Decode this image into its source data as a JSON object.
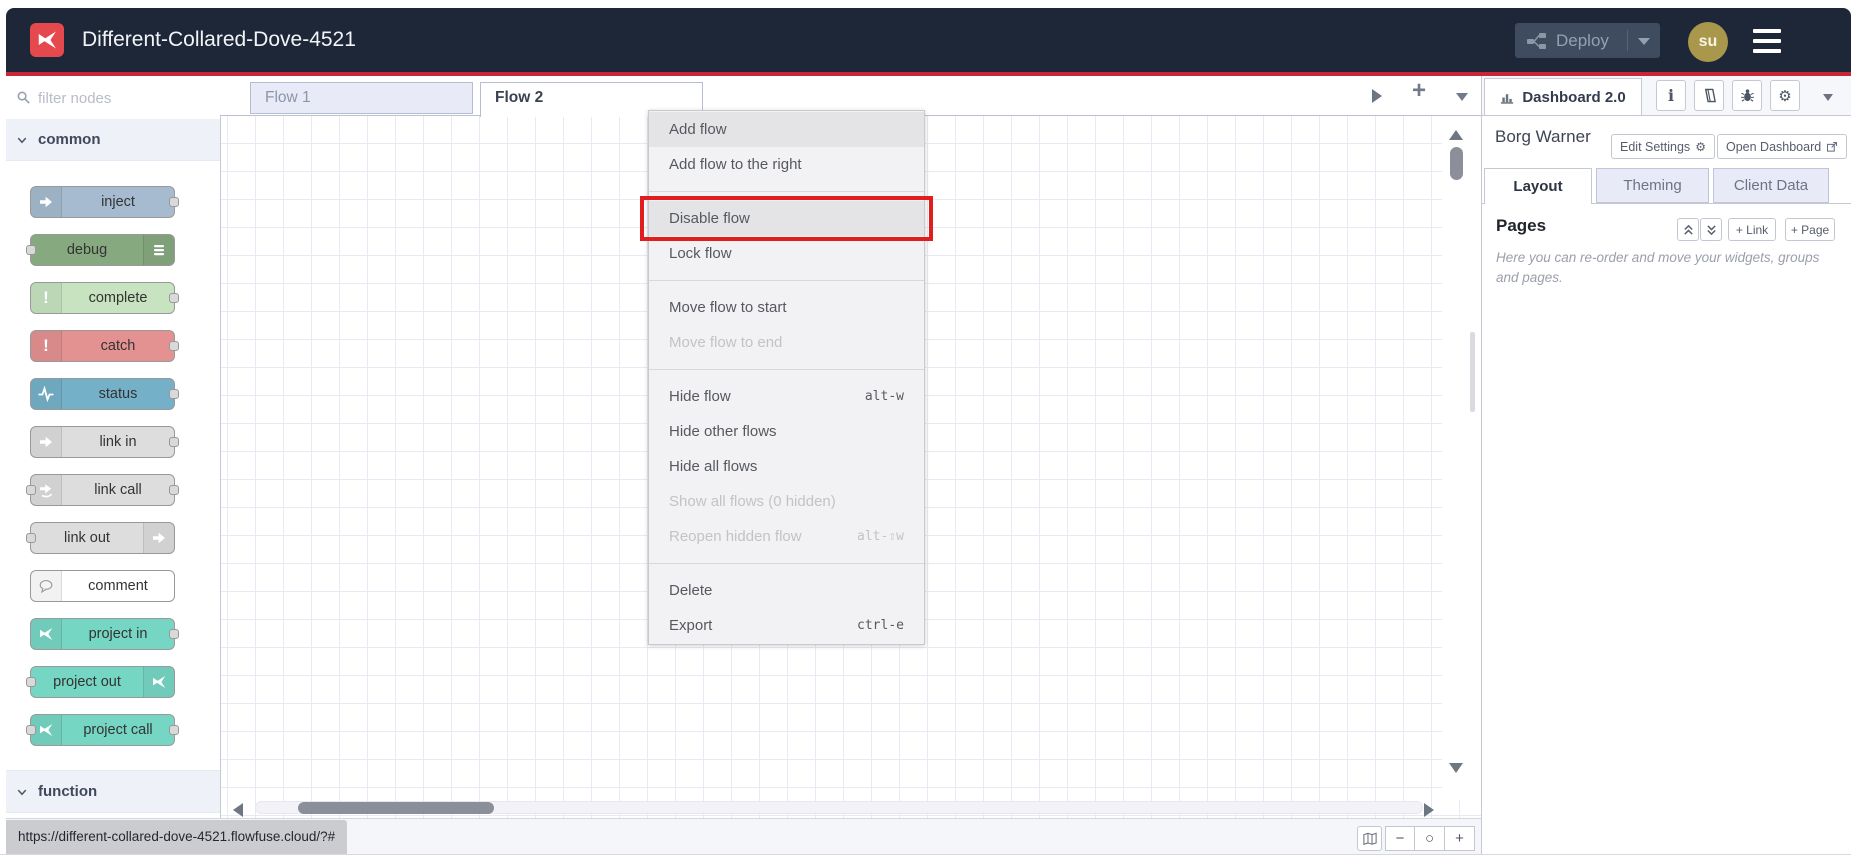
{
  "header": {
    "title": "Different-Collared-Dove-4521",
    "deploy": {
      "label": "Deploy"
    },
    "avatar": {
      "initials": "su"
    }
  },
  "palette": {
    "filter_placeholder": "filter nodes",
    "sections": [
      {
        "label": "common"
      },
      {
        "label": "function"
      }
    ],
    "nodes": [
      {
        "label": "inject",
        "color": "#a6bbcf",
        "icon": "inject-arrow-icon",
        "icon_side": "left",
        "ports": [
          "right"
        ]
      },
      {
        "label": "debug",
        "color": "#87a980",
        "icon": "list-lines-icon",
        "icon_side": "right",
        "ports": [
          "left"
        ]
      },
      {
        "label": "complete",
        "color": "#c7e3c0",
        "icon": "exclamation-icon",
        "icon_side": "left",
        "ports": [
          "right"
        ]
      },
      {
        "label": "catch",
        "color": "#e49191",
        "icon": "exclamation-icon",
        "icon_side": "left",
        "ports": [
          "right"
        ]
      },
      {
        "label": "status",
        "color": "#74b1c9",
        "icon": "pulse-icon",
        "icon_side": "left",
        "ports": [
          "right"
        ]
      },
      {
        "label": "link in",
        "color": "#dddddd",
        "icon": "link-arrow-icon",
        "icon_side": "left",
        "ports": [
          "right"
        ]
      },
      {
        "label": "link call",
        "color": "#dddddd",
        "icon": "link-loop-icon",
        "icon_side": "left",
        "ports": [
          "left",
          "right"
        ]
      },
      {
        "label": "link out",
        "color": "#dddddd",
        "icon": "link-arrow-icon",
        "icon_side": "right",
        "ports": [
          "left"
        ]
      },
      {
        "label": "comment",
        "color": "#ffffff",
        "icon": "comment-bubble-icon",
        "icon_side": "left",
        "ports": []
      },
      {
        "label": "project in",
        "color": "#76d6c4",
        "icon": "flowfuse-icon",
        "icon_side": "left",
        "ports": [
          "right"
        ]
      },
      {
        "label": "project out",
        "color": "#76d6c4",
        "icon": "flowfuse-icon",
        "icon_side": "right",
        "ports": [
          "left"
        ]
      },
      {
        "label": "project call",
        "color": "#76d6c4",
        "icon": "flowfuse-icon",
        "icon_side": "left",
        "ports": [
          "left",
          "right"
        ]
      }
    ]
  },
  "workspace": {
    "tabs": [
      {
        "label": "Flow 1",
        "active": false
      },
      {
        "label": "Flow 2",
        "active": true
      }
    ]
  },
  "context_menu": {
    "annotation_color": "#e01e1e",
    "items": [
      {
        "label": "Add flow",
        "hover": true
      },
      {
        "label": "Add flow to the right"
      },
      {
        "separator": true
      },
      {
        "label": "Disable flow",
        "hover": true,
        "annotated": true
      },
      {
        "label": "Lock flow"
      },
      {
        "separator": true
      },
      {
        "label": "Move flow to start"
      },
      {
        "label": "Move flow to end",
        "disabled": true
      },
      {
        "separator": true
      },
      {
        "label": "Hide flow",
        "shortcut": "alt-w"
      },
      {
        "label": "Hide other flows"
      },
      {
        "label": "Hide all flows"
      },
      {
        "label": "Show all flows (0 hidden)",
        "disabled": true
      },
      {
        "label": "Reopen hidden flow",
        "shortcut": "alt-⇧w",
        "disabled": true
      },
      {
        "separator": true
      },
      {
        "label": "Delete"
      },
      {
        "label": "Export",
        "shortcut": "ctrl-e"
      }
    ]
  },
  "sidebar": {
    "active_tab": "Dashboard 2.0",
    "project_name": "Borg Warner",
    "edit_settings_label": "Edit Settings",
    "open_dashboard_label": "Open Dashboard",
    "tabs": [
      {
        "label": "Layout",
        "active": true
      },
      {
        "label": "Theming",
        "active": false
      },
      {
        "label": "Client Data",
        "active": false
      }
    ],
    "pages": {
      "title": "Pages",
      "add_link_label": "+ Link",
      "add_page_label": "+ Page",
      "description": "Here you can re-order and move your widgets, groups and pages."
    }
  },
  "footer": {
    "url_status": "https://different-collared-dove-4521.flowfuse.cloud/?#",
    "zoom_out": "−",
    "zoom_reset": "○",
    "zoom_in": "+"
  }
}
